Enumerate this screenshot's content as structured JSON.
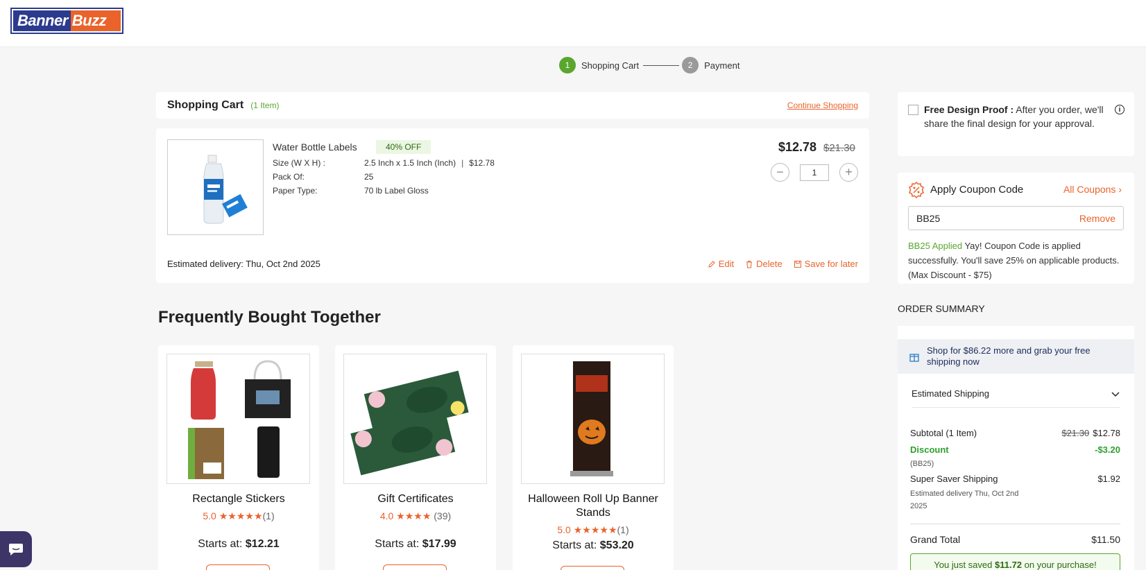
{
  "brand": {
    "logo_part1": "Banner",
    "logo_part2": "Buzz"
  },
  "stepper": [
    {
      "num": "1",
      "label": "Shopping Cart"
    },
    {
      "num": "2",
      "label": "Payment"
    }
  ],
  "cart": {
    "title": "Shopping Cart",
    "count": "(1 Item)",
    "continue_label": "Continue Shopping",
    "item": {
      "name": "Water Bottle Labels",
      "badge": "40% OFF",
      "specs": [
        {
          "key": "Size (W X H) :",
          "value": "2.5 Inch x 1.5 Inch (Inch)",
          "extra": "$12.78"
        },
        {
          "key": "Pack Of:",
          "value": "25"
        },
        {
          "key": "Paper Type:",
          "value": "70 lb Label Gloss"
        }
      ],
      "price": "$12.78",
      "old_price": "$21.30",
      "qty": "1",
      "delivery": "Estimated delivery: Thu, Oct 2nd 2025",
      "edit_label": "Edit",
      "delete_label": "Delete",
      "save_label": "Save for later"
    }
  },
  "fbt": {
    "title": "Frequently Bought Together",
    "products": [
      {
        "name": "Rectangle Stickers",
        "rating": "5.0",
        "stars": "★★★★★",
        "count": "(1)",
        "price_label": "Starts at:",
        "price": "$12.21"
      },
      {
        "name": "Gift Certificates",
        "rating": "4.0",
        "stars": "★★★★",
        "count": "(39)",
        "price_label": "Starts at:",
        "price": "$17.99"
      },
      {
        "name": "Halloween Roll Up Banner Stands",
        "rating": "5.0",
        "stars": "★★★★★",
        "count": "(1)",
        "price_label": "Starts at:",
        "price": "$53.20"
      }
    ]
  },
  "proof": {
    "bold": "Free Design Proof :",
    "text": " After you order, we'll share the final design for your approval."
  },
  "coupon": {
    "title": "Apply Coupon Code",
    "all_label": "All Coupons",
    "code": "BB25",
    "remove_label": "Remove",
    "applied": "BB25 Applied",
    "message": " Yay! Coupon Code is applied successfully. You'll save 25% on applicable products. (Max Discount - $75)"
  },
  "summary": {
    "title": "ORDER SUMMARY",
    "ship_banner": "Shop for $86.22 more and grab your free shipping now",
    "est_shipping_label": "Estimated Shipping",
    "subtotal_label": "Subtotal (1 Item)",
    "subtotal_old": "$21.30",
    "subtotal": "$12.78",
    "discount_label": "Discount",
    "discount": "-$3.20",
    "discount_code": "(BB25)",
    "shipping_label": "Super Saver Shipping",
    "shipping": "$1.92",
    "shipping_note": "Estimated delivery Thu, Oct 2nd 2025",
    "grand_label": "Grand Total",
    "grand": "$11.50",
    "saved_pre": "You just saved ",
    "saved_amount": "$11.72",
    "saved_post": " on your purchase!"
  },
  "colors": {
    "accent": "#e9632b",
    "green": "#5aa62e",
    "brand_blue": "#2d3b8e"
  }
}
